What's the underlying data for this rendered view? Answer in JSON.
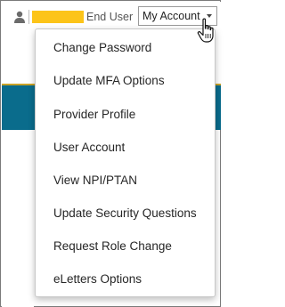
{
  "header": {
    "user_icon": "user-silhouette-icon",
    "name_redaction_color": "#fcc419",
    "role_text": "End User",
    "account_menu_label": "My Account",
    "account_menu_caret_icon": "caret-down-icon",
    "cursor_icon": "hand-pointer-cursor-icon"
  },
  "menu": {
    "items": [
      {
        "label": "Change Password"
      },
      {
        "label": "Update MFA Options"
      },
      {
        "label": "Provider Profile"
      },
      {
        "label": "User Account"
      },
      {
        "label": "View NPI/PTAN"
      },
      {
        "label": "Update Security Questions"
      },
      {
        "label": "Request Role Change"
      },
      {
        "label": "eLetters Options"
      }
    ]
  },
  "colors": {
    "banner": "#0a6c8c",
    "banner_accent": "#c9a227"
  }
}
